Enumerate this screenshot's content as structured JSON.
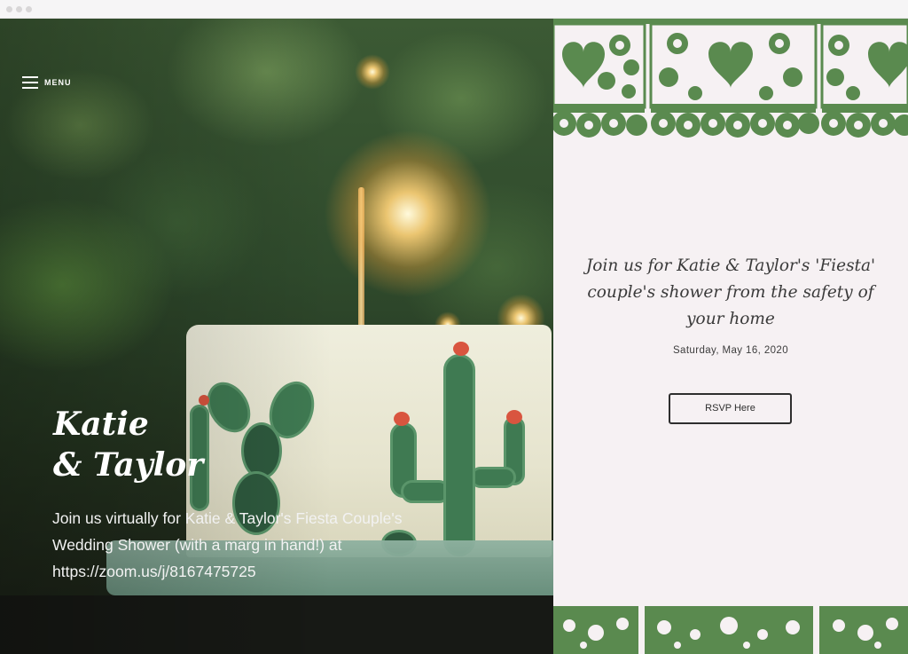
{
  "menu": {
    "label": "MENU"
  },
  "hero": {
    "title_line1": "Katie",
    "title_line2": "& Taylor",
    "description": "Join us virtually for Katie & Taylor's Fiesta Couple's Wedding Shower (with a marg in hand!) at https://zoom.us/j/8167475725"
  },
  "panel": {
    "invite_text": "Join us for Katie & Taylor's 'Fiesta' couple's shower from the safety of your home",
    "date": "Saturday, May 16, 2020",
    "rsvp_label": "RSVP Here"
  },
  "colors": {
    "papel_green": "#5a8a4f",
    "panel_bg": "#f6f1f3",
    "button_border": "#2e2e2e"
  }
}
